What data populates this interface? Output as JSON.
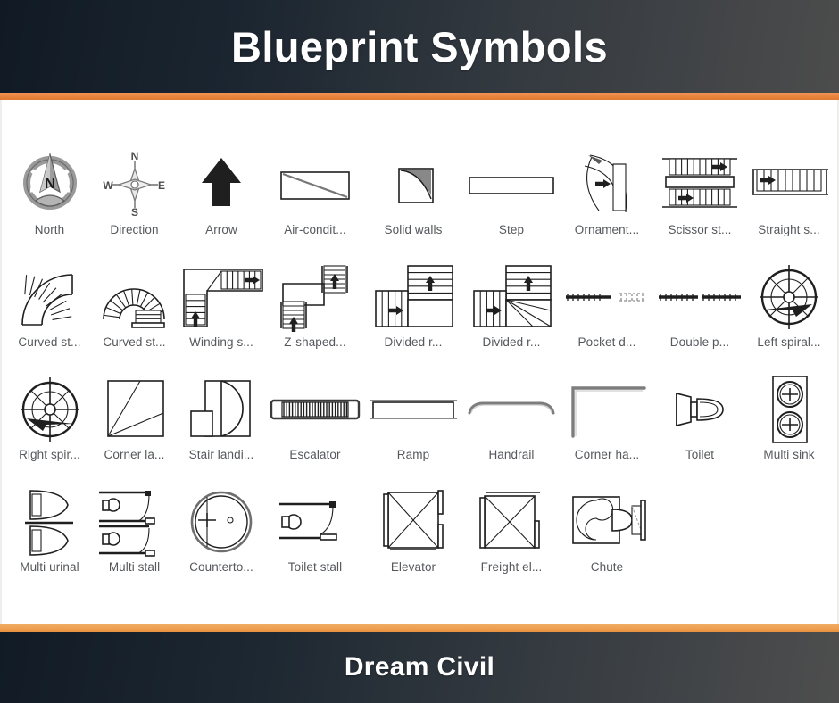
{
  "header": {
    "title": "Blueprint Symbols",
    "accent_color": "#e8823c",
    "background_start": "#111a24",
    "background_end": "#4c4c4c"
  },
  "footer": {
    "title": "Dream Civil",
    "accent_color": "#eda052"
  },
  "symbols": {
    "label_color": "#55585c",
    "columns": 9,
    "items": [
      {
        "label": "North",
        "icon": "compass-rose-north-icon"
      },
      {
        "label": "Direction",
        "icon": "compass-direction-icon"
      },
      {
        "label": "Arrow",
        "icon": "solid-up-arrow-icon"
      },
      {
        "label": "Air-condit...",
        "icon": "air-conditioner-icon"
      },
      {
        "label": "Solid walls",
        "icon": "solid-walls-icon"
      },
      {
        "label": "Step",
        "icon": "step-icon"
      },
      {
        "label": "Ornament...",
        "icon": "ornamental-stair-icon"
      },
      {
        "label": "Scissor st...",
        "icon": "scissor-stair-icon"
      },
      {
        "label": "Straight s...",
        "icon": "straight-stair-icon"
      },
      {
        "label": "Curved st...",
        "icon": "curved-stair-quarter-icon"
      },
      {
        "label": "Curved st...",
        "icon": "curved-stair-horseshoe-icon"
      },
      {
        "label": "Winding s...",
        "icon": "winding-stair-icon"
      },
      {
        "label": "Z-shaped...",
        "icon": "z-shaped-stair-icon"
      },
      {
        "label": "Divided r...",
        "icon": "divided-return-stair-icon"
      },
      {
        "label": "Divided r...",
        "icon": "divided-return-stair-winder-icon"
      },
      {
        "label": "Pocket d...",
        "icon": "pocket-door-icon"
      },
      {
        "label": "Double p...",
        "icon": "double-pocket-door-icon"
      },
      {
        "label": "Left spiral...",
        "icon": "left-spiral-stair-icon"
      },
      {
        "label": "Right spir...",
        "icon": "right-spiral-stair-icon"
      },
      {
        "label": "Corner la...",
        "icon": "corner-landing-icon"
      },
      {
        "label": "Stair landi...",
        "icon": "stair-landing-icon"
      },
      {
        "label": "Escalator",
        "icon": "escalator-icon"
      },
      {
        "label": "Ramp",
        "icon": "ramp-icon"
      },
      {
        "label": "Handrail",
        "icon": "handrail-icon"
      },
      {
        "label": "Corner ha...",
        "icon": "corner-handrail-icon"
      },
      {
        "label": "Toilet",
        "icon": "toilet-icon"
      },
      {
        "label": "Multi sink",
        "icon": "multi-sink-icon"
      },
      {
        "label": "Multi urinal",
        "icon": "multi-urinal-icon"
      },
      {
        "label": "Multi stall",
        "icon": "multi-stall-icon"
      },
      {
        "label": "Counterto...",
        "icon": "countertop-sink-icon"
      },
      {
        "label": "Toilet stall",
        "icon": "toilet-stall-icon"
      },
      {
        "label": "Elevator",
        "icon": "elevator-icon"
      },
      {
        "label": "Freight el...",
        "icon": "freight-elevator-icon"
      },
      {
        "label": "Chute",
        "icon": "chute-icon"
      }
    ]
  }
}
